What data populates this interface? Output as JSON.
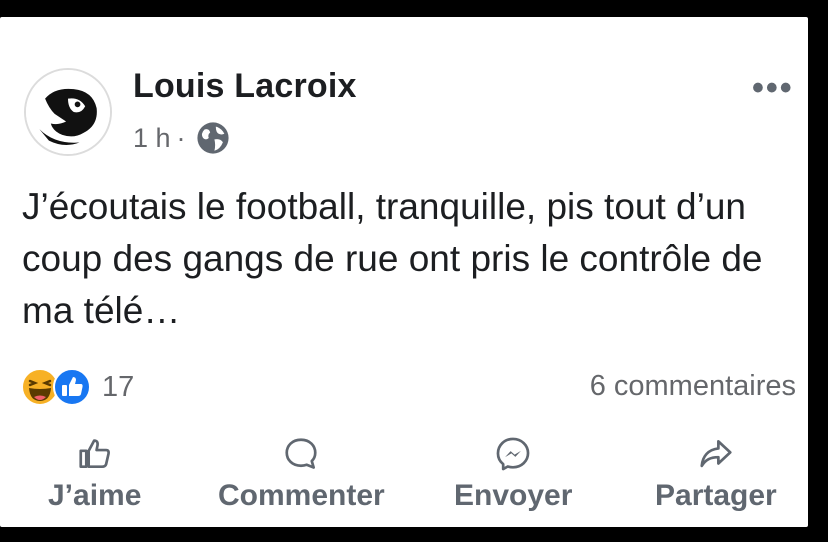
{
  "post": {
    "author": "Louis Lacroix",
    "time": "1 h",
    "separator": "·",
    "text": "J’écoutais le football, tranquille, pis tout d’un coup des gangs de rue ont pris le contrôle de ma télé…",
    "menu_icon": "more-options-icon",
    "privacy_icon": "globe-icon"
  },
  "stats": {
    "reaction_count": "17",
    "comments": "6 commentaires",
    "reaction_icons": [
      "haha-icon",
      "like-icon"
    ]
  },
  "actions": [
    {
      "label": "J’aime",
      "icon": "thumbs-up-icon"
    },
    {
      "label": "Commenter",
      "icon": "comment-icon"
    },
    {
      "label": "Envoyer",
      "icon": "messenger-icon"
    },
    {
      "label": "Partager",
      "icon": "share-icon"
    }
  ],
  "colors": {
    "text": "#1c1e21",
    "secondary": "#65676b",
    "like_blue": "#1877f2",
    "haha_yellow": "#f7b125",
    "background": "#000000"
  }
}
